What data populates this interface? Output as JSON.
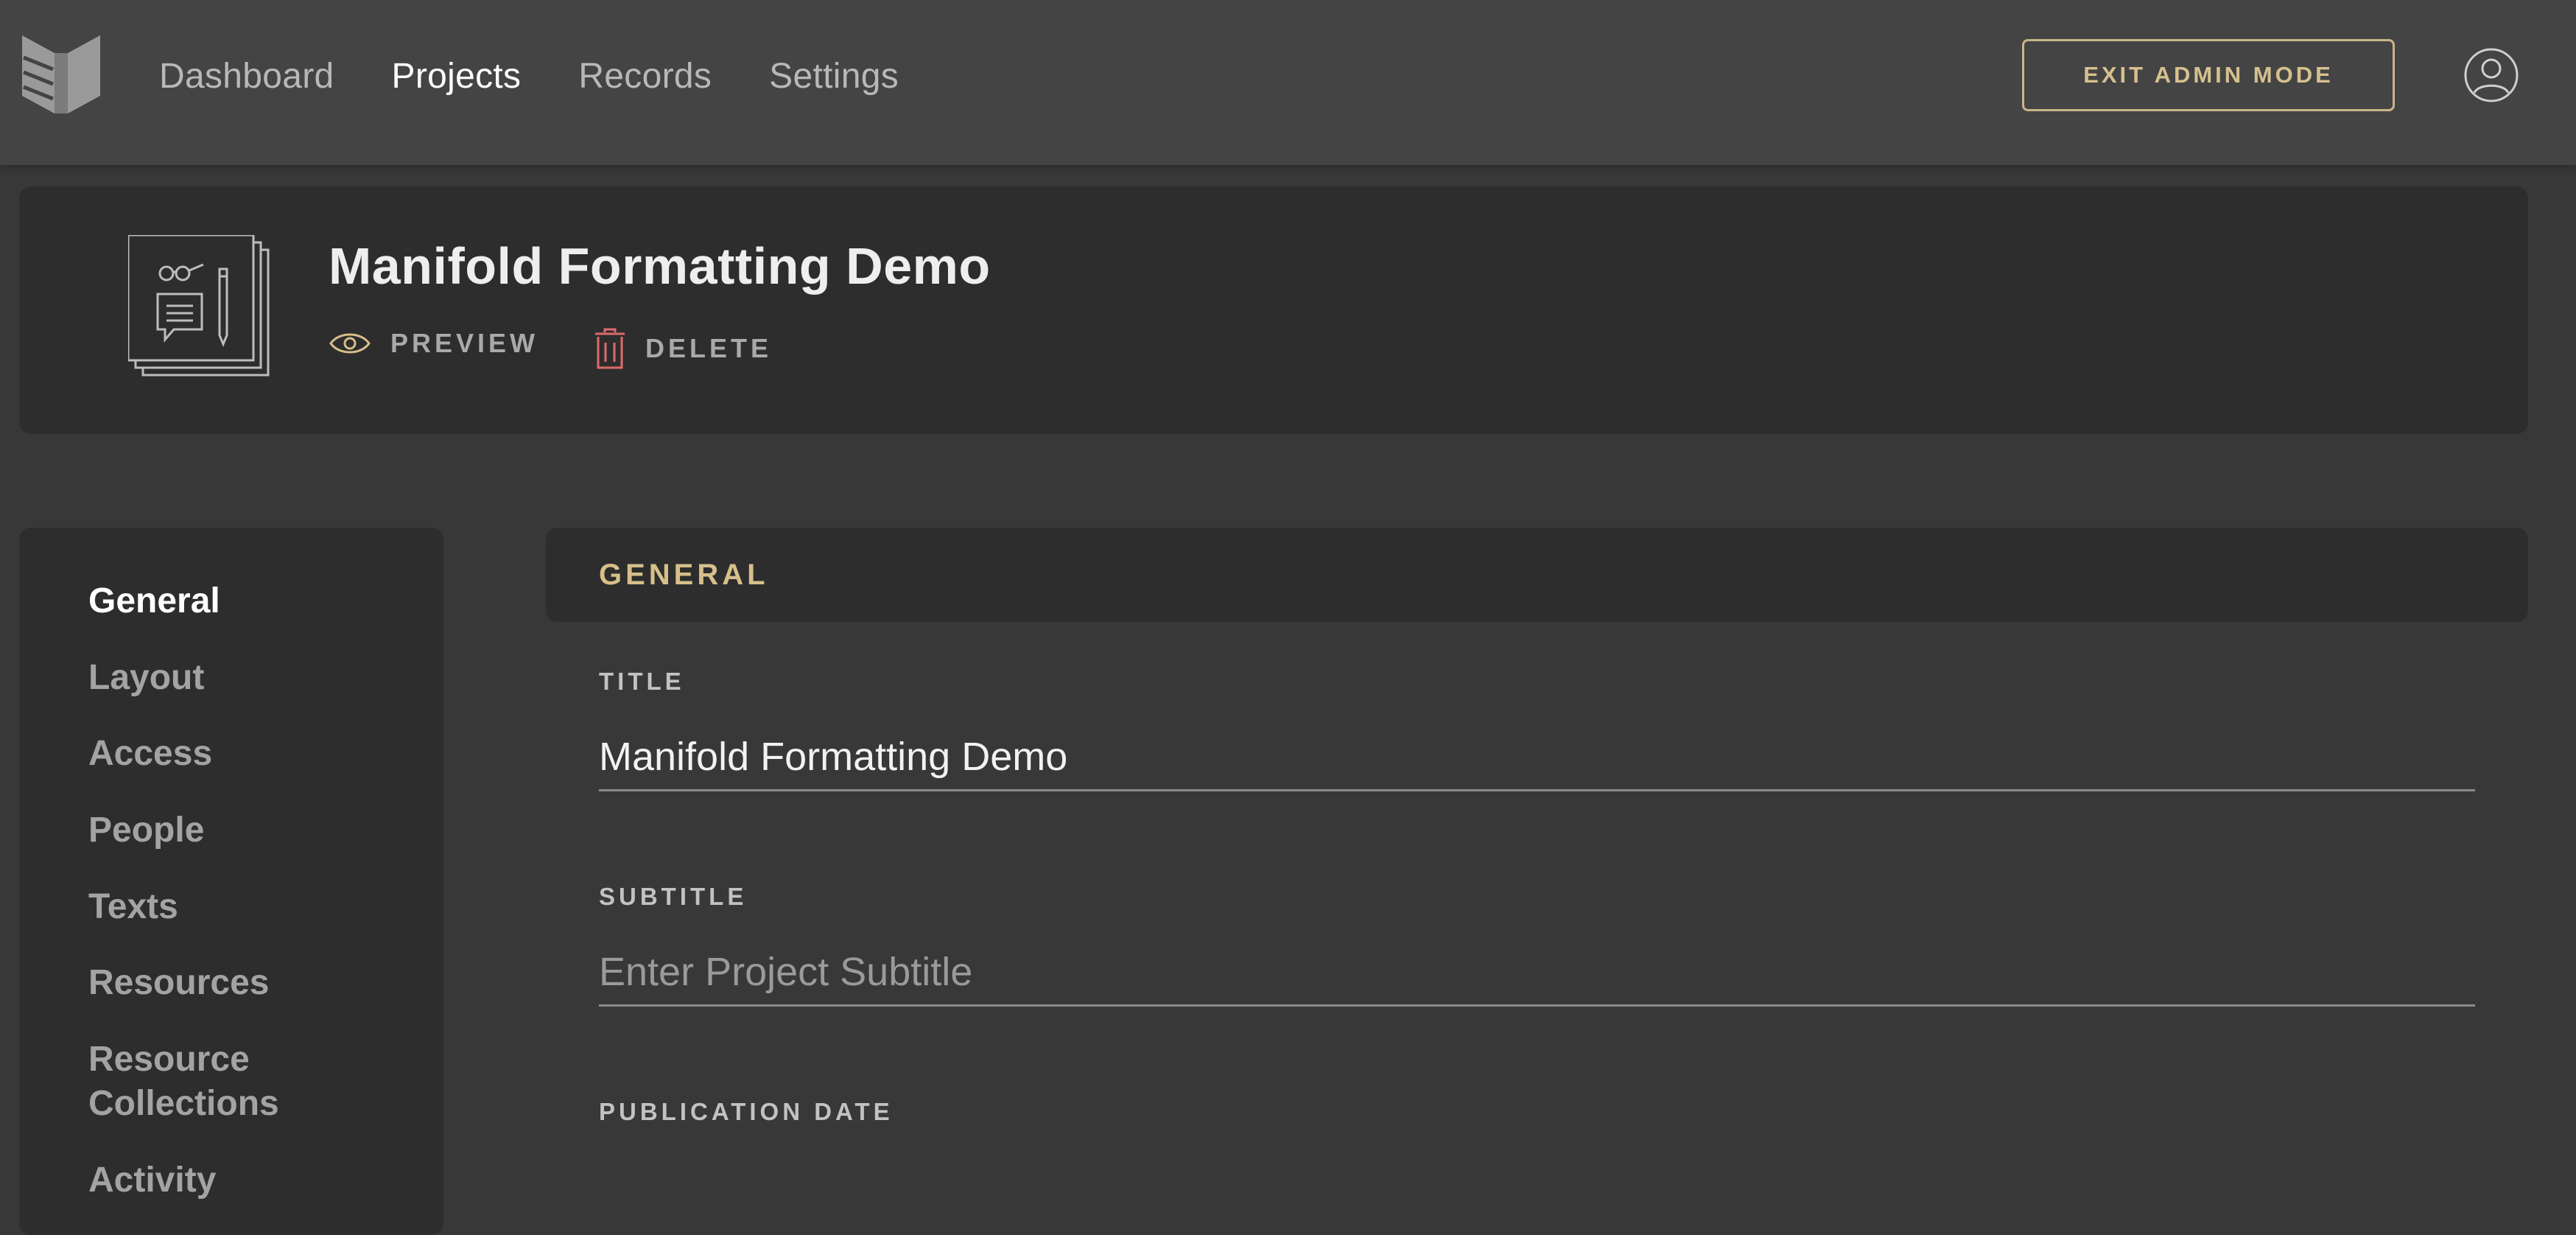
{
  "nav": {
    "items": [
      "Dashboard",
      "Projects",
      "Records",
      "Settings"
    ],
    "active": "Projects",
    "exit_label": "EXIT ADMIN MODE"
  },
  "project": {
    "title": "Manifold Formatting Demo",
    "preview_label": "PREVIEW",
    "delete_label": "DELETE"
  },
  "sidebar": {
    "items": [
      "General",
      "Layout",
      "Access",
      "People",
      "Texts",
      "Resources",
      "Resource Collections",
      "Activity"
    ],
    "active": "General"
  },
  "form": {
    "section_title": "GENERAL",
    "title_label": "TITLE",
    "title_value": "Manifold Formatting Demo",
    "subtitle_label": "SUBTITLE",
    "subtitle_placeholder": "Enter Project Subtitle",
    "pubdate_label": "PUBLICATION DATE"
  },
  "icons": {
    "logo": "manifold-logo-icon",
    "avatar": "user-circle-icon",
    "thumb": "project-stack-icon",
    "preview": "eye-icon",
    "delete": "trash-icon"
  },
  "colors": {
    "accent": "#d7bf8a",
    "delete": "#e06a6a",
    "card": "#2d2d2d",
    "background": "#383838",
    "topbar": "#444444"
  }
}
